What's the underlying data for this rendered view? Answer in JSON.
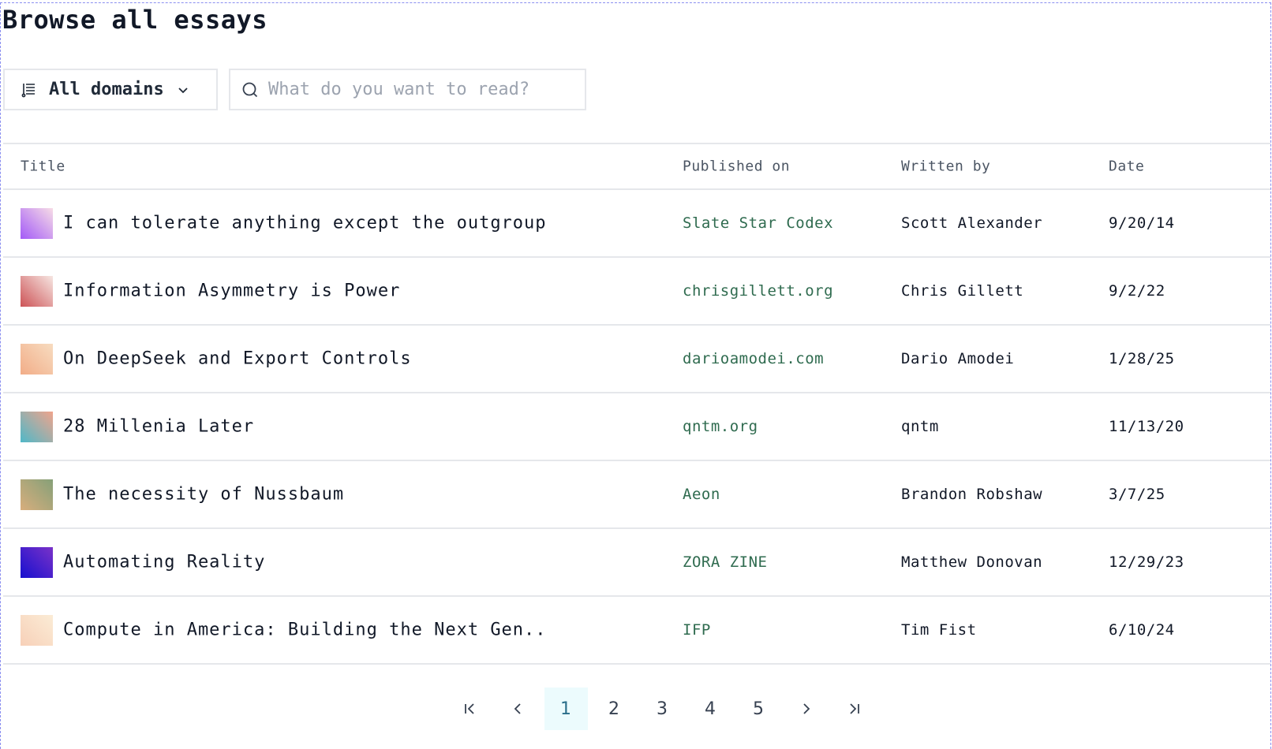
{
  "page": {
    "title": "Browse all essays"
  },
  "filters": {
    "domain_label": "All domains",
    "search_placeholder": "What do you want to read?",
    "search_value": ""
  },
  "table": {
    "headers": [
      "Title",
      "Published on",
      "Written by",
      "Date"
    ],
    "rows": [
      {
        "title": "I can tolerate anything except the outgroup",
        "published_on": "Slate Star Codex",
        "author": "Scott Alexander",
        "date": "9/20/14",
        "thumb": [
          "#a35af7",
          "#f7dce6"
        ]
      },
      {
        "title": "Information Asymmetry is Power",
        "published_on": "chrisgillett.org",
        "author": "Chris Gillett",
        "date": "9/2/22",
        "thumb": [
          "#cd5356",
          "#f6e6e2"
        ]
      },
      {
        "title": "On DeepSeek and Export Controls",
        "published_on": "darioamodei.com",
        "author": "Dario Amodei",
        "date": "1/28/25",
        "thumb": [
          "#f2ad88",
          "#f7dcc0"
        ]
      },
      {
        "title": "28 Millenia Later",
        "published_on": "qntm.org",
        "author": "qntm",
        "date": "11/13/20",
        "thumb": [
          "#4fb8c8",
          "#f0a48c"
        ]
      },
      {
        "title": "The necessity of Nussbaum",
        "published_on": "Aeon",
        "author": "Brandon Robshaw",
        "date": "3/7/25",
        "thumb": [
          "#d8ae7d",
          "#86a078"
        ]
      },
      {
        "title": "Automating Reality",
        "published_on": "ZORA ZINE",
        "author": "Matthew Donovan",
        "date": "12/29/23",
        "thumb": [
          "#1710cf",
          "#7a32c8"
        ]
      },
      {
        "title": "Compute in America: Building the Next Gen..",
        "published_on": "IFP",
        "author": "Tim Fist",
        "date": "6/10/24",
        "thumb": [
          "#f7d0b8",
          "#fbecd6"
        ]
      }
    ]
  },
  "pagination": {
    "pages": [
      "1",
      "2",
      "3",
      "4",
      "5"
    ],
    "current": "1",
    "icons": [
      "first-page-icon",
      "prev-page-icon",
      "next-page-icon",
      "last-page-icon"
    ]
  }
}
